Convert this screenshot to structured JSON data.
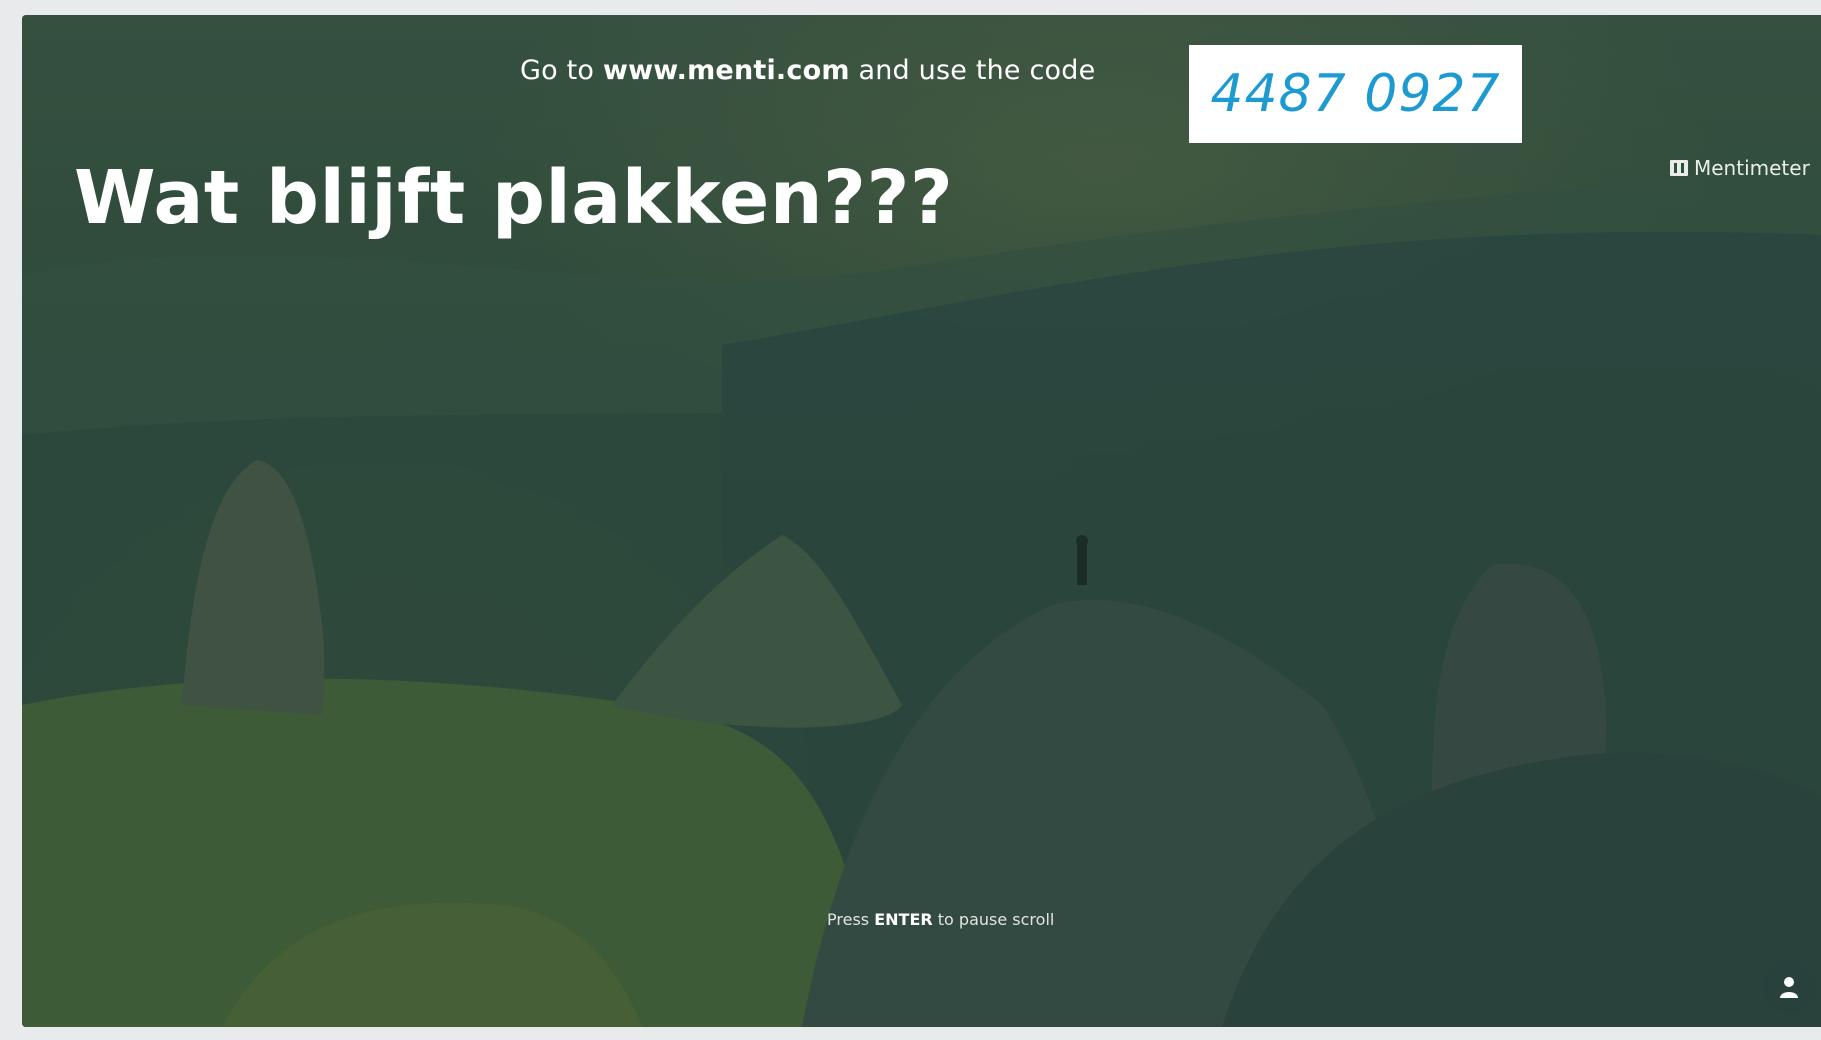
{
  "header": {
    "prefix": "Go to",
    "url": "www.menti.com",
    "suffix": "and use the code",
    "code": "4487 0927"
  },
  "brand": {
    "name": "Mentimeter",
    "icon": "mentimeter-logo-icon"
  },
  "slide": {
    "title": "Wat blijft plakken???"
  },
  "hint": {
    "prefix": "Press",
    "key": "ENTER",
    "suffix": "to pause scroll"
  },
  "controls": {
    "audience_icon": "person-icon"
  },
  "colors": {
    "code_text": "#1d9bd1",
    "code_box_bg": "#ffffff",
    "background_tint": "#2f4d44"
  }
}
